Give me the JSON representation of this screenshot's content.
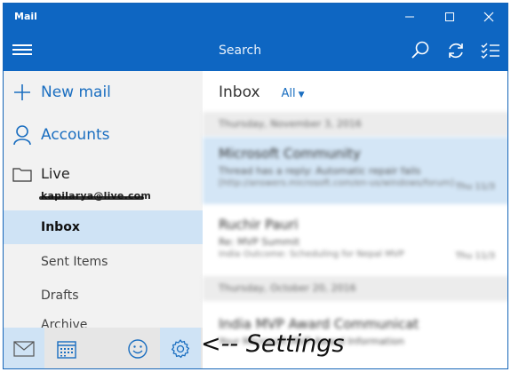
{
  "window": {
    "title": "Mail",
    "controls": {
      "minimize": "minimize-icon",
      "maximize": "maximize-icon",
      "close": "close-icon"
    }
  },
  "nav": {
    "menu_icon": "hamburger-icon",
    "new_mail": "New mail",
    "accounts": "Accounts",
    "account": {
      "name": "Live",
      "email": "kapilarya@live.com"
    },
    "folders": [
      {
        "label": "Inbox",
        "selected": true
      },
      {
        "label": "Sent Items",
        "selected": false
      },
      {
        "label": "Drafts",
        "selected": false
      },
      {
        "label": "Archive",
        "selected": false
      }
    ],
    "bottom_bar": [
      "mail-icon",
      "calendar-icon",
      "smiley-icon",
      "gear-icon"
    ]
  },
  "list": {
    "search_placeholder": "Search",
    "title": "Inbox",
    "filter": "All",
    "groups": [
      {
        "date": "Thursday, November 3, 2016",
        "messages": [
          {
            "sender": "Microsoft Community",
            "subject": "Thread has a reply: Automatic repair fails",
            "preview": "[http://answers.microsoft.com/en-us/windows/forum]",
            "time": "Thu 11/3"
          },
          {
            "sender": "Ruchir Pauri",
            "subject": "Re: MVP Summit",
            "preview": "India Outcome: Scheduling for Nepal MVP",
            "time": "Thu 11/3"
          }
        ]
      },
      {
        "date": "Thursday, October 20, 2016",
        "messages": [
          {
            "sender": "India MVP Award Communicat",
            "subject": "Your Microsoft MVP Award Information",
            "preview": "",
            "time": ""
          }
        ]
      }
    ]
  },
  "annotation": "<-- Settings"
}
